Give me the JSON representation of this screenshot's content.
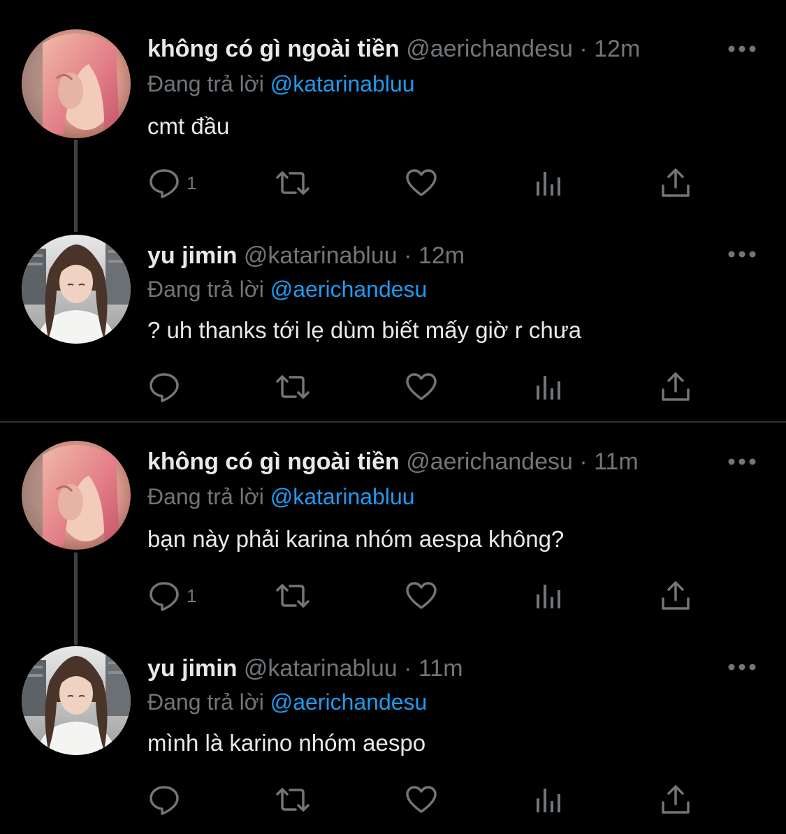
{
  "threads": [
    {
      "tweets": [
        {
          "author_name": "không có gì ngoài tiền",
          "handle": "@aerichandesu",
          "separator": "·",
          "time": "12m",
          "reply_prefix": "Đang trả lời",
          "reply_to": "@katarinabluu",
          "text": "cmt đầu",
          "reply_count": "1",
          "avatar_icon": "avatar-pink-hair"
        },
        {
          "author_name": "yu jimin",
          "handle": "@katarinabluu",
          "separator": "·",
          "time": "12m",
          "reply_prefix": "Đang trả lời",
          "reply_to": "@aerichandesu",
          "text": "? uh thanks tới lẹ dùm biết mấy giờ r chưa",
          "reply_count": "",
          "avatar_icon": "avatar-brown-hair"
        }
      ]
    },
    {
      "tweets": [
        {
          "author_name": "không có gì ngoài tiền",
          "handle": "@aerichandesu",
          "separator": "·",
          "time": "11m",
          "reply_prefix": "Đang trả lời",
          "reply_to": "@katarinabluu",
          "text": "bạn này phải karina nhóm aespa không?",
          "reply_count": "1",
          "avatar_icon": "avatar-pink-hair"
        },
        {
          "author_name": "yu jimin",
          "handle": "@katarinabluu",
          "separator": "·",
          "time": "11m",
          "reply_prefix": "Đang trả lời",
          "reply_to": "@aerichandesu",
          "text": "mình là karino nhóm aespo",
          "reply_count": "",
          "avatar_icon": "avatar-brown-hair"
        }
      ]
    }
  ],
  "icons": {
    "reply": "reply-icon",
    "retweet": "retweet-icon",
    "like": "heart-icon",
    "views": "views-icon",
    "share": "share-icon",
    "more": "more-icon"
  },
  "colors": {
    "background": "#000000",
    "text": "#e7e9ea",
    "muted": "#71767b",
    "link": "#1d9bf0",
    "divider": "#2f3336"
  }
}
